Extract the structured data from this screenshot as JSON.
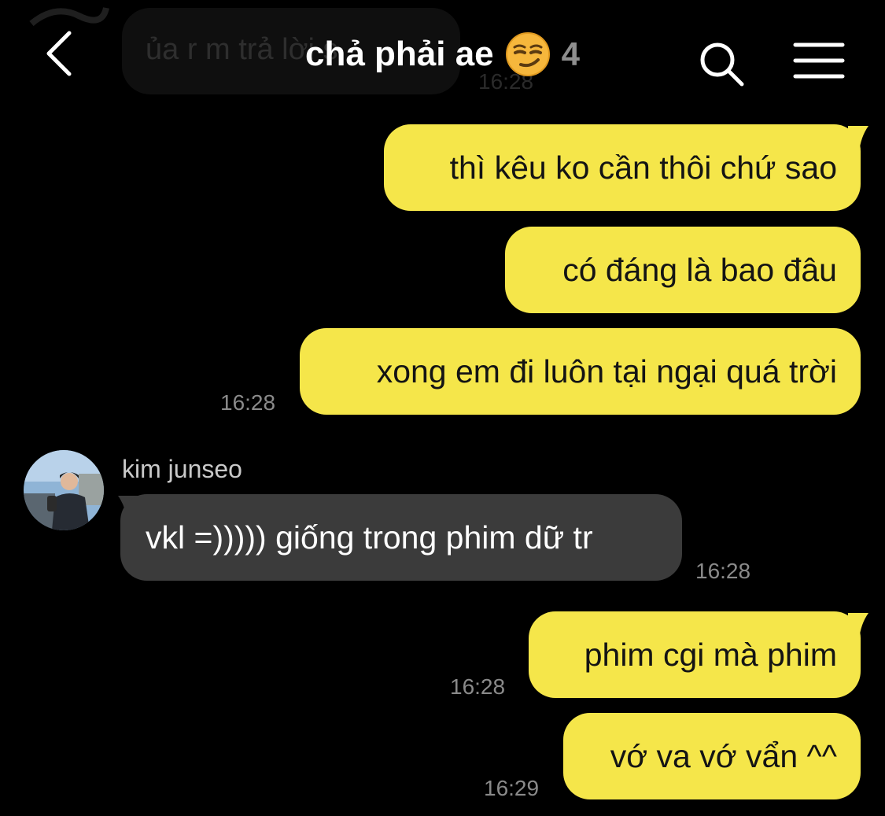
{
  "header": {
    "title": "chả phải ae",
    "member_count": "4",
    "emoji": "smirking-face-emoji"
  },
  "previous_message": {
    "text": "ủa r m trả lời s",
    "time": "16:28"
  },
  "messages": [
    {
      "direction": "outgoing",
      "text": "thì kêu ko cần thôi chứ sao",
      "time": ""
    },
    {
      "direction": "outgoing",
      "text": "có đáng là bao đâu",
      "time": ""
    },
    {
      "direction": "outgoing",
      "text": "xong em đi luôn tại ngại quá trời",
      "time": "16:28"
    },
    {
      "direction": "incoming",
      "sender": "kim junseo",
      "text": "vkl =))))) giống trong phim dữ tr",
      "time": "16:28"
    },
    {
      "direction": "outgoing",
      "text": "phim cgi mà phim",
      "time": "16:28"
    },
    {
      "direction": "outgoing",
      "text": "vớ va vớ vẩn ^^",
      "time": "16:29"
    }
  ],
  "colors": {
    "background": "#000000",
    "outgoing_bubble": "#f5e64a",
    "incoming_bubble": "#3b3b3b",
    "timestamp": "#8a8a8a"
  },
  "icons": [
    "back-chevron-icon",
    "search-icon",
    "menu-icon"
  ]
}
